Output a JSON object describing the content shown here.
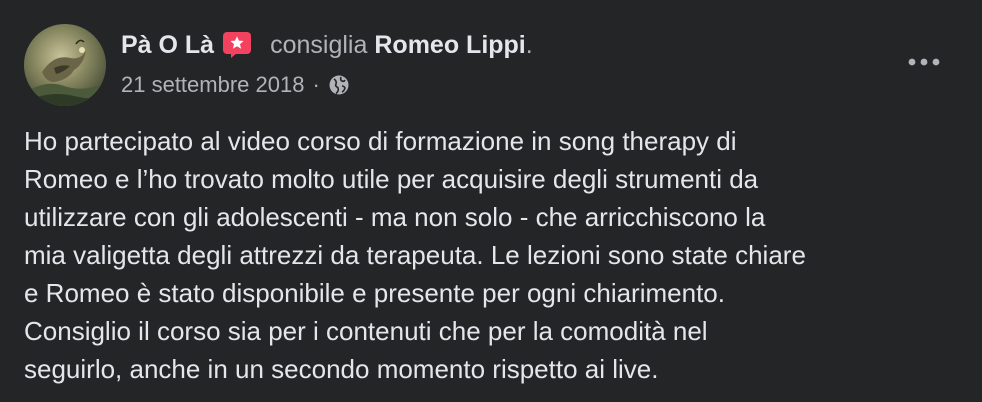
{
  "post": {
    "author": "Pà O Là",
    "action": "consiglia",
    "target": "Romeo Lippi",
    "period": ".",
    "date": "21 settembre 2018",
    "separator": "·",
    "privacy_icon": "globe-icon",
    "more_icon": "more-horizontal-icon",
    "badge_icon": "star-badge-icon",
    "badge_color": "#f3425f",
    "body_lines": [
      "Ho partecipato al video corso di formazione in song therapy di",
      "Romeo e l’ho trovato molto utile per acquisire degli strumenti da",
      "utilizzare con gli adolescenti - ma non solo - che arricchiscono la",
      "mia valigetta degli attrezzi da terapeuta. Le lezioni sono state chiare",
      "e Romeo è stato disponibile e presente per ogni chiarimento.",
      "Consiglio il corso sia per i contenuti che per la comodità nel",
      "seguirlo, anche in un secondo momento rispetto ai live."
    ]
  },
  "colors": {
    "background": "#242526",
    "primary_text": "#e4e6eb",
    "secondary_text": "#b0b3b8"
  }
}
